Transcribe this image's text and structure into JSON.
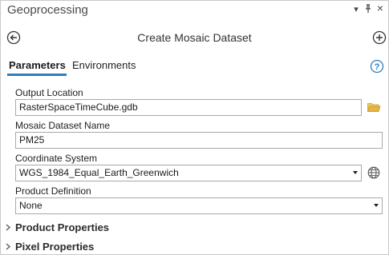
{
  "window": {
    "title": "Geoprocessing",
    "controls": {
      "menu": "▾",
      "pin": "⊥",
      "close": "×"
    }
  },
  "header": {
    "title": "Create Mosaic Dataset",
    "back_icon": "back-arrow-icon",
    "add_icon": "add-icon"
  },
  "tabs": [
    {
      "label": "Parameters",
      "active": true
    },
    {
      "label": "Environments",
      "active": false
    }
  ],
  "help_icon": "help-icon",
  "params": {
    "output_location": {
      "label": "Output Location",
      "value": "RasterSpaceTimeCube.gdb",
      "icon": "folder-icon"
    },
    "mosaic_name": {
      "label": "Mosaic Dataset Name",
      "value": "PM25"
    },
    "coordinate_system": {
      "label": "Coordinate System",
      "value": "WGS_1984_Equal_Earth_Greenwich",
      "icon": "globe-icon"
    },
    "product_definition": {
      "label": "Product Definition",
      "value": "None"
    }
  },
  "groups": [
    {
      "label": "Product Properties",
      "expanded": false
    },
    {
      "label": "Pixel Properties",
      "expanded": false
    }
  ],
  "colors": {
    "accent": "#2d7ebd",
    "folder": "#e3b545",
    "border": "#a9a9a9"
  }
}
